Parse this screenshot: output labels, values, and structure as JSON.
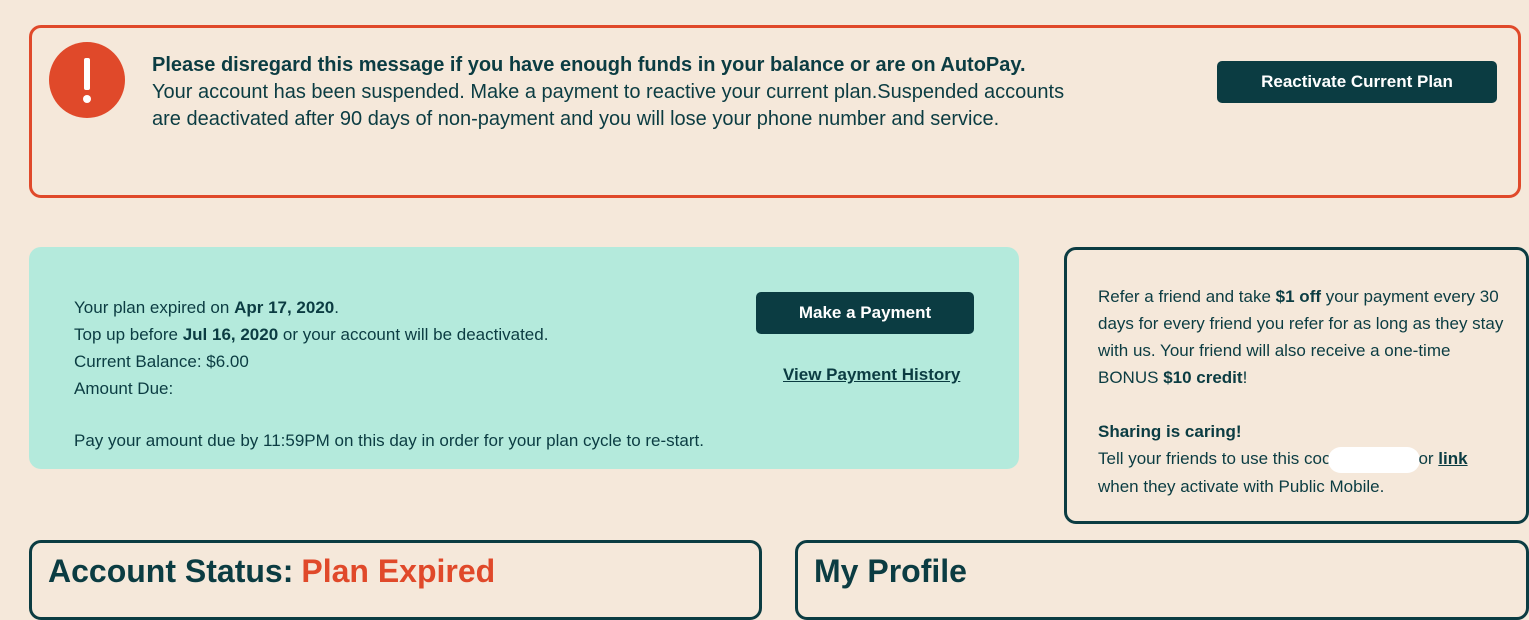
{
  "alert": {
    "icon": "exclamation-icon",
    "heading": "Please disregard this message if you have enough funds in your balance or are on AutoPay.",
    "body": "Your account has been suspended. Make a payment to reactive your current plan.Suspended accounts are deactivated after 90 days of non-payment and you will lose your phone number and service.",
    "button_label": "Reactivate Current Plan",
    "border_color": "#e0492a"
  },
  "plan": {
    "expired_prefix": "Your plan expired on ",
    "expired_date": "Apr 17, 2020",
    "expired_suffix": ".",
    "topup_prefix": "Top up before ",
    "topup_date": "Jul 16, 2020",
    "topup_suffix": " or your account will be deactivated.",
    "balance_label": "Current Balance: $6.00",
    "amount_due_label": "Amount Due:",
    "note": "Pay your amount due by 11:59PM on this day in order for your plan cycle to re-start.",
    "pay_button": "Make a Payment",
    "history_link": "View Payment History",
    "background": "#b4eadc"
  },
  "refer": {
    "p1_a": "Refer a friend and take ",
    "p1_b": "$1 off",
    "p1_c": " your payment every 30 days for every friend you refer for as long as they stay with us. Your friend will also receive a one-time BONUS ",
    "p1_d": "$10 credit",
    "p1_e": "!",
    "share_title": "Sharing is caring!",
    "share_a": "Tell your friends to use this coc",
    "share_b": "or ",
    "share_link": "link",
    "share_c": " when they activate with Public Mobile."
  },
  "account_status": {
    "label": "Account Status:",
    "value": "Plan Expired"
  },
  "profile": {
    "title": "My Profile"
  },
  "colors": {
    "background": "#f5e8da",
    "primary": "#0b3c42",
    "accent": "#e0492a"
  }
}
